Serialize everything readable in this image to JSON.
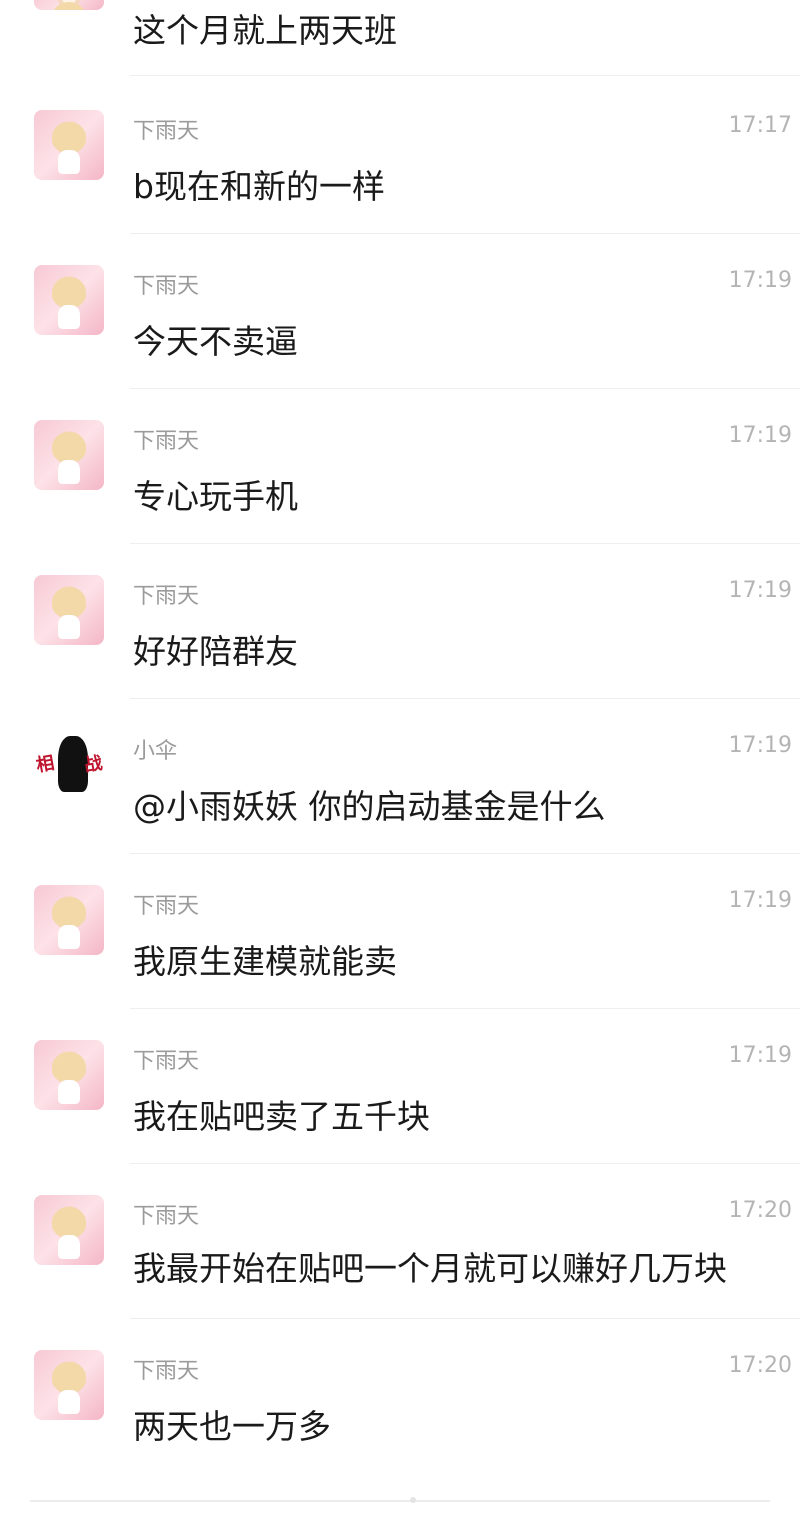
{
  "messages": [
    {
      "sender": "",
      "time": "",
      "text": "这个月就上两天班",
      "avatar": "anime-girl-avatar"
    },
    {
      "sender": "下雨天",
      "time": "17:17",
      "text": "b现在和新的一样",
      "avatar": "anime-girl-avatar"
    },
    {
      "sender": "下雨天",
      "time": "17:19",
      "text": "今天不卖逼",
      "avatar": "anime-girl-avatar"
    },
    {
      "sender": "下雨天",
      "time": "17:19",
      "text": "专心玩手机",
      "avatar": "anime-girl-avatar"
    },
    {
      "sender": "下雨天",
      "time": "17:19",
      "text": "好好陪群友",
      "avatar": "anime-girl-avatar"
    },
    {
      "sender": "小伞",
      "time": "17:19",
      "text": "@小雨妖妖 你的启动基金是什么",
      "avatar": "ink-figure-avatar",
      "avatar_text": [
        "相",
        "战"
      ]
    },
    {
      "sender": "下雨天",
      "time": "17:19",
      "text": "我原生建模就能卖",
      "avatar": "anime-girl-avatar"
    },
    {
      "sender": "下雨天",
      "time": "17:19",
      "text": "我在贴吧卖了五千块",
      "avatar": "anime-girl-avatar"
    },
    {
      "sender": "下雨天",
      "time": "17:20",
      "text": "我最开始在贴吧一个月就可以赚好几万块",
      "avatar": "anime-girl-avatar"
    },
    {
      "sender": "下雨天",
      "time": "17:20",
      "text": "两天也一万多",
      "avatar": "anime-girl-avatar"
    }
  ]
}
